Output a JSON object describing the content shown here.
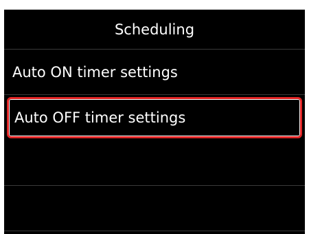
{
  "header": {
    "title": "Scheduling"
  },
  "menu": {
    "items": [
      {
        "label": "Auto ON timer settings",
        "selected": false
      },
      {
        "label": "Auto OFF timer settings",
        "selected": true
      },
      {
        "label": "",
        "selected": false
      },
      {
        "label": "",
        "selected": false
      }
    ]
  },
  "colors": {
    "background": "#000000",
    "text": "#ffffff",
    "selection_border": "#e02424"
  }
}
